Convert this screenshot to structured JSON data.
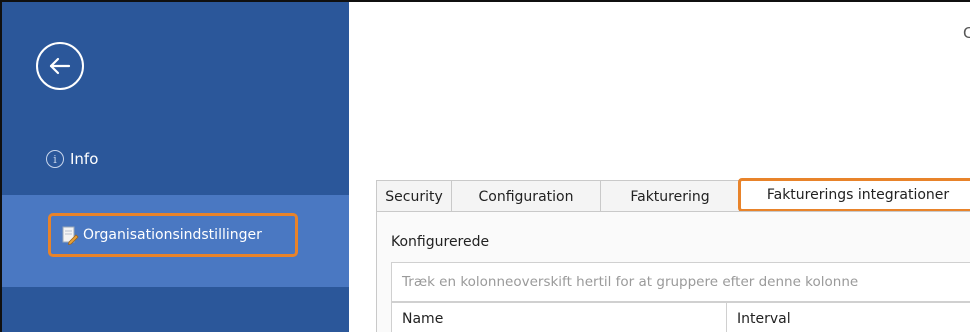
{
  "sidebar": {
    "back_icon": "arrow-left-icon",
    "info_label": "Info",
    "info_icon": "info-circle-icon",
    "org_label": "Organisationsindstillinger",
    "org_icon": "document-edit-icon",
    "colors": {
      "background": "#2b579a",
      "selected": "#4a78c2",
      "highlight": "#e8832a"
    }
  },
  "header": {
    "corner_text": "C"
  },
  "tabs": [
    {
      "label": "Security",
      "active": false
    },
    {
      "label": "Configuration",
      "active": false
    },
    {
      "label": "Fakturering",
      "active": false
    },
    {
      "label": "Fakturerings integrationer",
      "active": true
    }
  ],
  "panel": {
    "title": "Konfigurerede",
    "group_placeholder": "Træk en kolonneoverskift hertil for at gruppere efter denne kolonne",
    "columns": [
      "Name",
      "Interval"
    ]
  }
}
